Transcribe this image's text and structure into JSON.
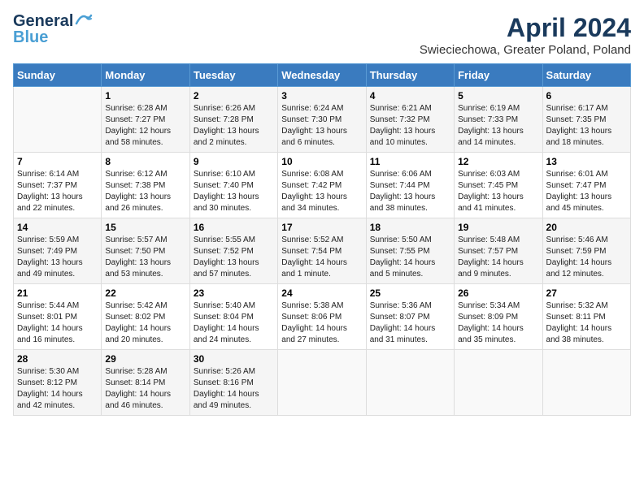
{
  "header": {
    "logo_line1": "General",
    "logo_line2": "Blue",
    "month": "April 2024",
    "location": "Swieciechowa, Greater Poland, Poland"
  },
  "weekdays": [
    "Sunday",
    "Monday",
    "Tuesday",
    "Wednesday",
    "Thursday",
    "Friday",
    "Saturday"
  ],
  "weeks": [
    [
      {
        "day": "",
        "sunrise": "",
        "sunset": "",
        "daylight": ""
      },
      {
        "day": "1",
        "sunrise": "Sunrise: 6:28 AM",
        "sunset": "Sunset: 7:27 PM",
        "daylight": "Daylight: 12 hours and 58 minutes."
      },
      {
        "day": "2",
        "sunrise": "Sunrise: 6:26 AM",
        "sunset": "Sunset: 7:28 PM",
        "daylight": "Daylight: 13 hours and 2 minutes."
      },
      {
        "day": "3",
        "sunrise": "Sunrise: 6:24 AM",
        "sunset": "Sunset: 7:30 PM",
        "daylight": "Daylight: 13 hours and 6 minutes."
      },
      {
        "day": "4",
        "sunrise": "Sunrise: 6:21 AM",
        "sunset": "Sunset: 7:32 PM",
        "daylight": "Daylight: 13 hours and 10 minutes."
      },
      {
        "day": "5",
        "sunrise": "Sunrise: 6:19 AM",
        "sunset": "Sunset: 7:33 PM",
        "daylight": "Daylight: 13 hours and 14 minutes."
      },
      {
        "day": "6",
        "sunrise": "Sunrise: 6:17 AM",
        "sunset": "Sunset: 7:35 PM",
        "daylight": "Daylight: 13 hours and 18 minutes."
      }
    ],
    [
      {
        "day": "7",
        "sunrise": "Sunrise: 6:14 AM",
        "sunset": "Sunset: 7:37 PM",
        "daylight": "Daylight: 13 hours and 22 minutes."
      },
      {
        "day": "8",
        "sunrise": "Sunrise: 6:12 AM",
        "sunset": "Sunset: 7:38 PM",
        "daylight": "Daylight: 13 hours and 26 minutes."
      },
      {
        "day": "9",
        "sunrise": "Sunrise: 6:10 AM",
        "sunset": "Sunset: 7:40 PM",
        "daylight": "Daylight: 13 hours and 30 minutes."
      },
      {
        "day": "10",
        "sunrise": "Sunrise: 6:08 AM",
        "sunset": "Sunset: 7:42 PM",
        "daylight": "Daylight: 13 hours and 34 minutes."
      },
      {
        "day": "11",
        "sunrise": "Sunrise: 6:06 AM",
        "sunset": "Sunset: 7:44 PM",
        "daylight": "Daylight: 13 hours and 38 minutes."
      },
      {
        "day": "12",
        "sunrise": "Sunrise: 6:03 AM",
        "sunset": "Sunset: 7:45 PM",
        "daylight": "Daylight: 13 hours and 41 minutes."
      },
      {
        "day": "13",
        "sunrise": "Sunrise: 6:01 AM",
        "sunset": "Sunset: 7:47 PM",
        "daylight": "Daylight: 13 hours and 45 minutes."
      }
    ],
    [
      {
        "day": "14",
        "sunrise": "Sunrise: 5:59 AM",
        "sunset": "Sunset: 7:49 PM",
        "daylight": "Daylight: 13 hours and 49 minutes."
      },
      {
        "day": "15",
        "sunrise": "Sunrise: 5:57 AM",
        "sunset": "Sunset: 7:50 PM",
        "daylight": "Daylight: 13 hours and 53 minutes."
      },
      {
        "day": "16",
        "sunrise": "Sunrise: 5:55 AM",
        "sunset": "Sunset: 7:52 PM",
        "daylight": "Daylight: 13 hours and 57 minutes."
      },
      {
        "day": "17",
        "sunrise": "Sunrise: 5:52 AM",
        "sunset": "Sunset: 7:54 PM",
        "daylight": "Daylight: 14 hours and 1 minute."
      },
      {
        "day": "18",
        "sunrise": "Sunrise: 5:50 AM",
        "sunset": "Sunset: 7:55 PM",
        "daylight": "Daylight: 14 hours and 5 minutes."
      },
      {
        "day": "19",
        "sunrise": "Sunrise: 5:48 AM",
        "sunset": "Sunset: 7:57 PM",
        "daylight": "Daylight: 14 hours and 9 minutes."
      },
      {
        "day": "20",
        "sunrise": "Sunrise: 5:46 AM",
        "sunset": "Sunset: 7:59 PM",
        "daylight": "Daylight: 14 hours and 12 minutes."
      }
    ],
    [
      {
        "day": "21",
        "sunrise": "Sunrise: 5:44 AM",
        "sunset": "Sunset: 8:01 PM",
        "daylight": "Daylight: 14 hours and 16 minutes."
      },
      {
        "day": "22",
        "sunrise": "Sunrise: 5:42 AM",
        "sunset": "Sunset: 8:02 PM",
        "daylight": "Daylight: 14 hours and 20 minutes."
      },
      {
        "day": "23",
        "sunrise": "Sunrise: 5:40 AM",
        "sunset": "Sunset: 8:04 PM",
        "daylight": "Daylight: 14 hours and 24 minutes."
      },
      {
        "day": "24",
        "sunrise": "Sunrise: 5:38 AM",
        "sunset": "Sunset: 8:06 PM",
        "daylight": "Daylight: 14 hours and 27 minutes."
      },
      {
        "day": "25",
        "sunrise": "Sunrise: 5:36 AM",
        "sunset": "Sunset: 8:07 PM",
        "daylight": "Daylight: 14 hours and 31 minutes."
      },
      {
        "day": "26",
        "sunrise": "Sunrise: 5:34 AM",
        "sunset": "Sunset: 8:09 PM",
        "daylight": "Daylight: 14 hours and 35 minutes."
      },
      {
        "day": "27",
        "sunrise": "Sunrise: 5:32 AM",
        "sunset": "Sunset: 8:11 PM",
        "daylight": "Daylight: 14 hours and 38 minutes."
      }
    ],
    [
      {
        "day": "28",
        "sunrise": "Sunrise: 5:30 AM",
        "sunset": "Sunset: 8:12 PM",
        "daylight": "Daylight: 14 hours and 42 minutes."
      },
      {
        "day": "29",
        "sunrise": "Sunrise: 5:28 AM",
        "sunset": "Sunset: 8:14 PM",
        "daylight": "Daylight: 14 hours and 46 minutes."
      },
      {
        "day": "30",
        "sunrise": "Sunrise: 5:26 AM",
        "sunset": "Sunset: 8:16 PM",
        "daylight": "Daylight: 14 hours and 49 minutes."
      },
      {
        "day": "",
        "sunrise": "",
        "sunset": "",
        "daylight": ""
      },
      {
        "day": "",
        "sunrise": "",
        "sunset": "",
        "daylight": ""
      },
      {
        "day": "",
        "sunrise": "",
        "sunset": "",
        "daylight": ""
      },
      {
        "day": "",
        "sunrise": "",
        "sunset": "",
        "daylight": ""
      }
    ]
  ]
}
